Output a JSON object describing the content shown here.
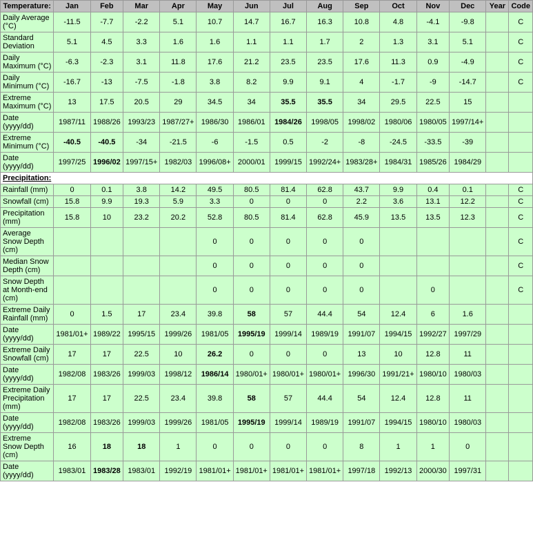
{
  "headers": {
    "label": "Temperature:",
    "months": [
      "Jan",
      "Feb",
      "Mar",
      "Apr",
      "May",
      "Jun",
      "Jul",
      "Aug",
      "Sep",
      "Oct",
      "Nov",
      "Dec",
      "Year",
      "Code"
    ]
  },
  "rows": [
    {
      "label": "Daily Average (°C)",
      "values": [
        "-11.5",
        "-7.7",
        "-2.2",
        "5.1",
        "10.7",
        "14.7",
        "16.7",
        "16.3",
        "10.8",
        "4.8",
        "-4.1",
        "-9.8",
        "",
        "C"
      ],
      "bold": []
    },
    {
      "label": "Standard Deviation",
      "values": [
        "5.1",
        "4.5",
        "3.3",
        "1.6",
        "1.6",
        "1.1",
        "1.1",
        "1.7",
        "2",
        "1.3",
        "3.1",
        "5.1",
        "",
        "C"
      ],
      "bold": []
    },
    {
      "label": "Daily Maximum (°C)",
      "values": [
        "-6.3",
        "-2.3",
        "3.1",
        "11.8",
        "17.6",
        "21.2",
        "23.5",
        "23.5",
        "17.6",
        "11.3",
        "0.9",
        "-4.9",
        "",
        "C"
      ],
      "bold": []
    },
    {
      "label": "Daily Minimum (°C)",
      "values": [
        "-16.7",
        "-13",
        "-7.5",
        "-1.8",
        "3.8",
        "8.2",
        "9.9",
        "9.1",
        "4",
        "-1.7",
        "-9",
        "-14.7",
        "",
        "C"
      ],
      "bold": []
    },
    {
      "label": "Extreme Maximum (°C)",
      "values": [
        "13",
        "17.5",
        "20.5",
        "29",
        "34.5",
        "34",
        "35.5",
        "35.5",
        "34",
        "29.5",
        "22.5",
        "15",
        "",
        ""
      ],
      "bold": [
        "35.5"
      ]
    },
    {
      "label": "Date (yyyy/dd)",
      "values": [
        "1987/11",
        "1988/26",
        "1993/23",
        "1987/27+",
        "1986/30",
        "1986/01",
        "1984/26",
        "1998/05",
        "1998/02",
        "1980/06",
        "1980/05",
        "1997/14+",
        "",
        ""
      ],
      "bold": [
        "1984/26"
      ]
    },
    {
      "label": "Extreme Minimum (°C)",
      "values": [
        "-40.5",
        "-40.5",
        "-34",
        "-21.5",
        "-6",
        "-1.5",
        "0.5",
        "-2",
        "-8",
        "-24.5",
        "-33.5",
        "-39",
        "",
        ""
      ],
      "bold": [
        "-40.5"
      ]
    },
    {
      "label": "Date (yyyy/dd)",
      "values": [
        "1997/25",
        "1996/02",
        "1997/15+",
        "1982/03",
        "1996/08+",
        "2000/01",
        "1999/15",
        "1992/24+",
        "1983/28+",
        "1984/31",
        "1985/26",
        "1984/29",
        "",
        ""
      ],
      "bold": [
        "1996/02"
      ]
    },
    {
      "section": "Precipitation:"
    },
    {
      "label": "Rainfall (mm)",
      "values": [
        "0",
        "0.1",
        "3.8",
        "14.2",
        "49.5",
        "80.5",
        "81.4",
        "62.8",
        "43.7",
        "9.9",
        "0.4",
        "0.1",
        "",
        "C"
      ],
      "bold": []
    },
    {
      "label": "Snowfall (cm)",
      "values": [
        "15.8",
        "9.9",
        "19.3",
        "5.9",
        "3.3",
        "0",
        "0",
        "0",
        "2.2",
        "3.6",
        "13.1",
        "12.2",
        "",
        "C"
      ],
      "bold": []
    },
    {
      "label": "Precipitation (mm)",
      "values": [
        "15.8",
        "10",
        "23.2",
        "20.2",
        "52.8",
        "80.5",
        "81.4",
        "62.8",
        "45.9",
        "13.5",
        "13.5",
        "12.3",
        "",
        "C"
      ],
      "bold": []
    },
    {
      "label": "Average Snow Depth (cm)",
      "values": [
        "",
        "",
        "",
        "",
        "0",
        "0",
        "0",
        "0",
        "0",
        "",
        "",
        "",
        "",
        "C"
      ],
      "bold": []
    },
    {
      "label": "Median Snow Depth (cm)",
      "values": [
        "",
        "",
        "",
        "",
        "0",
        "0",
        "0",
        "0",
        "0",
        "",
        "",
        "",
        "",
        "C"
      ],
      "bold": []
    },
    {
      "label": "Snow Depth at Month-end (cm)",
      "values": [
        "",
        "",
        "",
        "",
        "0",
        "0",
        "0",
        "0",
        "0",
        "",
        "0",
        "",
        "",
        "C"
      ],
      "bold": []
    },
    {
      "label": "Extreme Daily Rainfall (mm)",
      "values": [
        "0",
        "1.5",
        "17",
        "23.4",
        "39.8",
        "58",
        "57",
        "44.4",
        "54",
        "12.4",
        "6",
        "1.6",
        "",
        ""
      ],
      "bold": [
        "58"
      ]
    },
    {
      "label": "Date (yyyy/dd)",
      "values": [
        "1981/01+",
        "1989/22",
        "1995/15",
        "1999/26",
        "1981/05",
        "1995/19",
        "1999/14",
        "1989/19",
        "1991/07",
        "1994/15",
        "1992/27",
        "1997/29",
        "",
        ""
      ],
      "bold": [
        "1995/19"
      ]
    },
    {
      "label": "Extreme Daily Snowfall (cm)",
      "values": [
        "17",
        "17",
        "22.5",
        "10",
        "26.2",
        "0",
        "0",
        "0",
        "13",
        "10",
        "12.8",
        "11",
        "",
        ""
      ],
      "bold": [
        "26.2"
      ]
    },
    {
      "label": "Date (yyyy/dd)",
      "values": [
        "1982/08",
        "1983/26",
        "1999/03",
        "1998/12",
        "1986/14",
        "1980/01+",
        "1980/01+",
        "1980/01+",
        "1996/30",
        "1991/21+",
        "1980/10",
        "1980/03",
        "",
        ""
      ],
      "bold": [
        "1986/14"
      ]
    },
    {
      "label": "Extreme Daily Precipitation (mm)",
      "values": [
        "17",
        "17",
        "22.5",
        "23.4",
        "39.8",
        "58",
        "57",
        "44.4",
        "54",
        "12.4",
        "12.8",
        "11",
        "",
        ""
      ],
      "bold": [
        "58"
      ]
    },
    {
      "label": "Date (yyyy/dd)",
      "values": [
        "1982/08",
        "1983/26",
        "1999/03",
        "1999/26",
        "1981/05",
        "1995/19",
        "1999/14",
        "1989/19",
        "1991/07",
        "1994/15",
        "1980/10",
        "1980/03",
        "",
        ""
      ],
      "bold": [
        "1995/19"
      ]
    },
    {
      "label": "Extreme Snow Depth (cm)",
      "values": [
        "16",
        "18",
        "18",
        "1",
        "0",
        "0",
        "0",
        "0",
        "8",
        "1",
        "1",
        "0",
        "",
        ""
      ],
      "bold": [
        "18"
      ]
    },
    {
      "label": "Date (yyyy/dd)",
      "values": [
        "1983/01",
        "1983/28",
        "1983/01",
        "1992/19",
        "1981/01+",
        "1981/01+",
        "1981/01+",
        "1981/01+",
        "1997/18",
        "1992/13",
        "2000/30",
        "1997/31",
        "",
        ""
      ],
      "bold": [
        "1983/28"
      ]
    }
  ]
}
